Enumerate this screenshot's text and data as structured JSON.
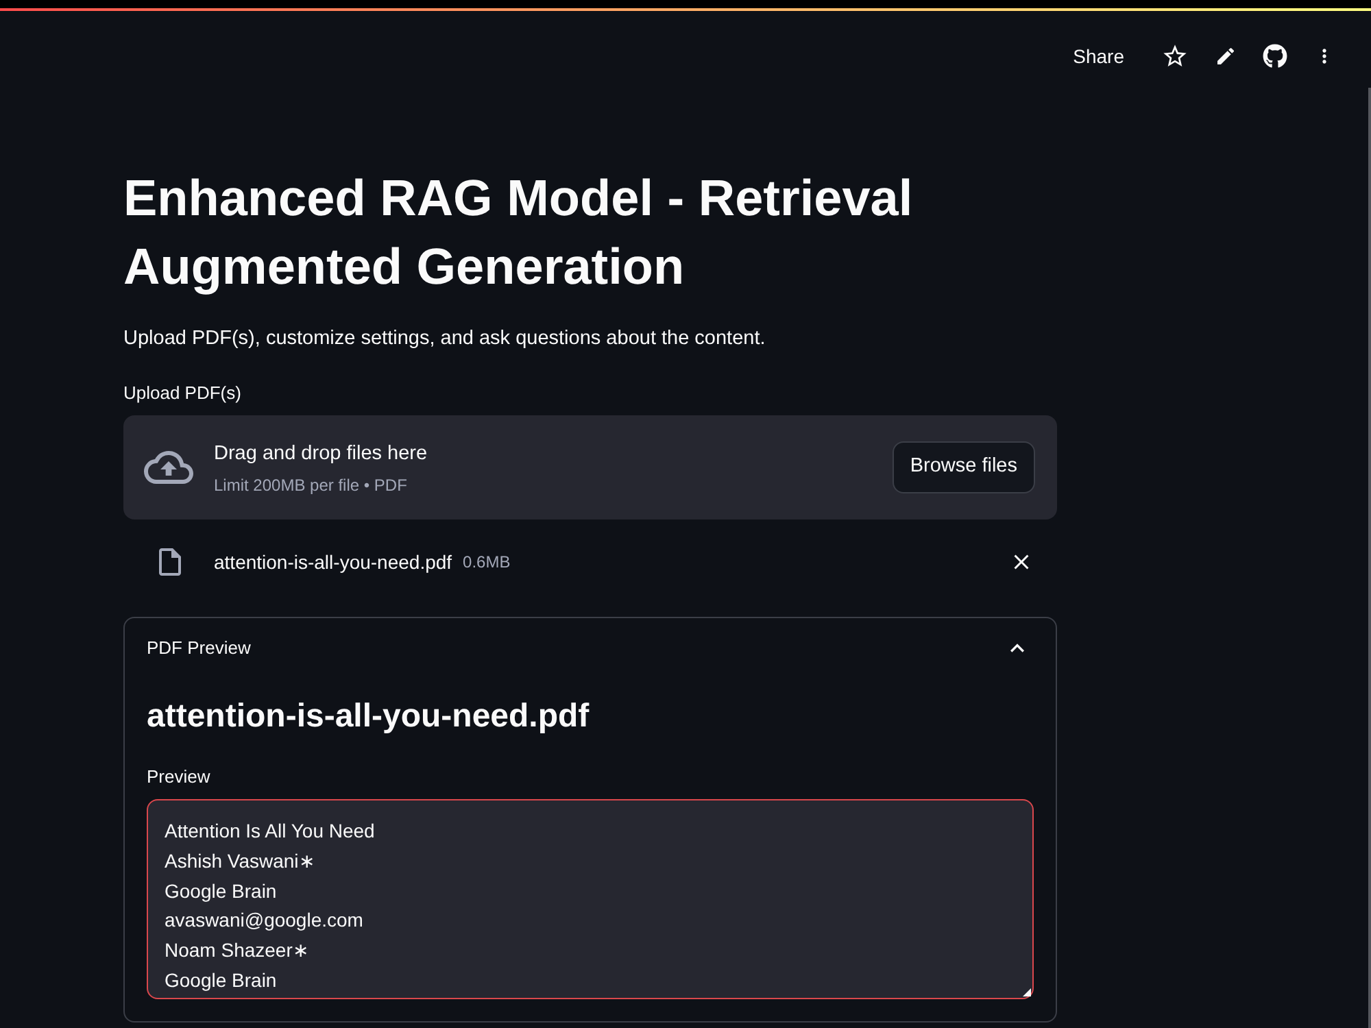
{
  "top_bar": {
    "share": "Share"
  },
  "page": {
    "title": "Enhanced RAG Model - Retrieval Augmented Generation",
    "subtitle": "Upload PDF(s), customize settings, and ask questions about the content."
  },
  "uploader": {
    "label": "Upload PDF(s)",
    "dropzone_title": "Drag and drop files here",
    "dropzone_hint": "Limit 200MB per file • PDF",
    "button": "Browse files",
    "files": [
      {
        "name": "attention-is-all-you-need.pdf",
        "size": "0.6MB"
      }
    ]
  },
  "expander": {
    "title": "PDF Preview",
    "expanded": true,
    "heading": "attention-is-all-you-need.pdf",
    "preview": {
      "label": "Preview",
      "focused": true,
      "lines": [
        "Attention Is All You Need",
        "Ashish Vaswani∗",
        "Google Brain",
        "avaswani@google.com",
        "Noam Shazeer∗",
        "Google Brain"
      ]
    }
  }
}
